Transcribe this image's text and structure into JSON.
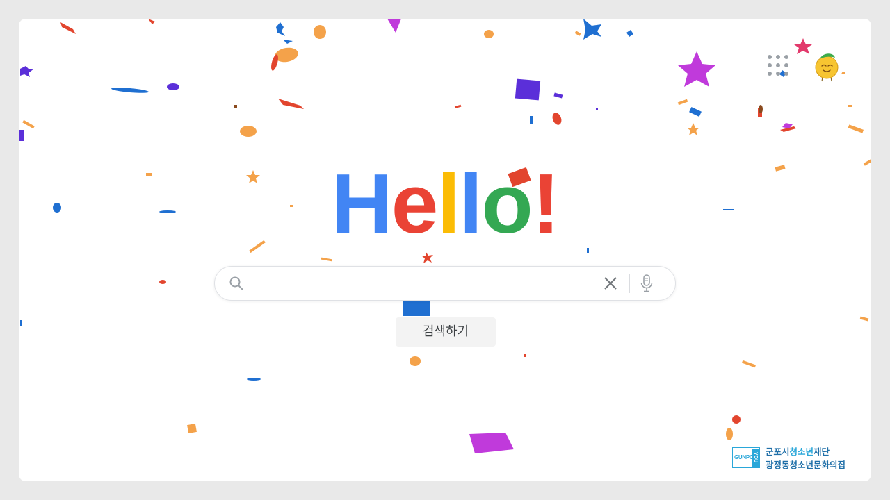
{
  "logo": {
    "letters": [
      {
        "char": "H",
        "color": "#4285f4"
      },
      {
        "char": "e",
        "color": "#ea4335"
      },
      {
        "char": "l",
        "color": "#fbbc05"
      },
      {
        "char": "l",
        "color": "#4285f4"
      },
      {
        "char": "o",
        "color": "#34a853"
      },
      {
        "char": "!",
        "color": "#ea4335"
      }
    ]
  },
  "search": {
    "value": "",
    "placeholder": "",
    "search_icon": "search-icon",
    "clear_icon": "close-icon",
    "voice_icon": "microphone-icon"
  },
  "search_button": {
    "label": "검색하기"
  },
  "header": {
    "apps_icon": "apps-grid-icon",
    "avatar_icon": "smiling-character-avatar"
  },
  "sponsor": {
    "mark_main": "GUNPO",
    "mark_side": "YOU",
    "line1_prefix": "군포시",
    "line1_highlight": "청소년",
    "line1_suffix": "재단",
    "line2": "광정동청소년문화의집"
  },
  "colors": {
    "blue": "#4285f4",
    "red": "#ea4335",
    "yellow": "#fbbc05",
    "green": "#34a853",
    "confetti_orange": "#f4a24a",
    "confetti_purple": "#5b2fd9",
    "confetti_magenta": "#c03adb"
  }
}
